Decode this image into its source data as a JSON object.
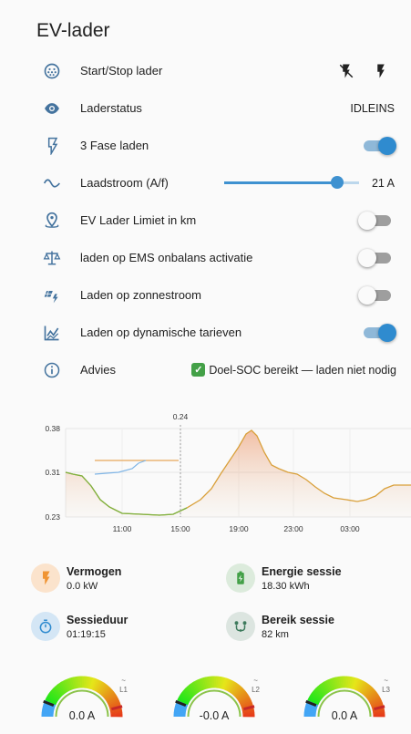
{
  "header": {
    "title": "EV-lader"
  },
  "rows": {
    "start_stop": {
      "label": "Start/Stop lader",
      "icon": "ev-plug-icon"
    },
    "status": {
      "label": "Laderstatus",
      "value": "IDLEINS",
      "icon": "eye-icon"
    },
    "three_phase": {
      "label": "3 Fase laden",
      "on": true,
      "icon": "flash-icon"
    },
    "current": {
      "label": "Laadstroom (A/f)",
      "value": "21 A",
      "level": 0.84,
      "icon": "sine-wave-icon"
    },
    "limit_km": {
      "label": "EV Lader Limiet in km",
      "on": false,
      "icon": "map-marker-icon"
    },
    "ems": {
      "label": "laden op EMS onbalans activatie",
      "on": false,
      "icon": "scale-balance-icon"
    },
    "solar": {
      "label": "Laden op zonnestroom",
      "on": false,
      "icon": "solar-power-icon"
    },
    "dynamic": {
      "label": "Laden op dynamische tarieven",
      "on": true,
      "icon": "chart-line-icon"
    },
    "advice": {
      "label": "Advies",
      "value": "Doel-SOC bereikt — laden niet nodig",
      "icon": "info-icon"
    }
  },
  "chart_data": {
    "type": "line",
    "yticks": [
      "0.38",
      "0.31",
      "0.23"
    ],
    "xticks": [
      "11:00",
      "15:00",
      "19:00",
      "23:00",
      "03:00"
    ],
    "cursor_label": "0.24",
    "ylim": [
      0.23,
      0.38
    ]
  },
  "stats": {
    "power": {
      "label": "Vermogen",
      "value": "0.0 kW",
      "color": "#f4a261"
    },
    "energy": {
      "label": "Energie sessie",
      "value": "18.30 kWh",
      "color": "#43a047"
    },
    "duration": {
      "label": "Sessieduur",
      "value": "01:19:15",
      "color": "#2f8bcf"
    },
    "range": {
      "label": "Bereik sessie",
      "value": "82 km",
      "color": "#3d7a5c"
    }
  },
  "gauges": [
    {
      "phase": "L1",
      "value": "0.0 A"
    },
    {
      "phase": "L2",
      "value": "-0.0 A"
    },
    {
      "phase": "L3",
      "value": "0.0 A"
    }
  ],
  "colors": {
    "accent": "#2f8bcf",
    "icon": "#44739e"
  }
}
